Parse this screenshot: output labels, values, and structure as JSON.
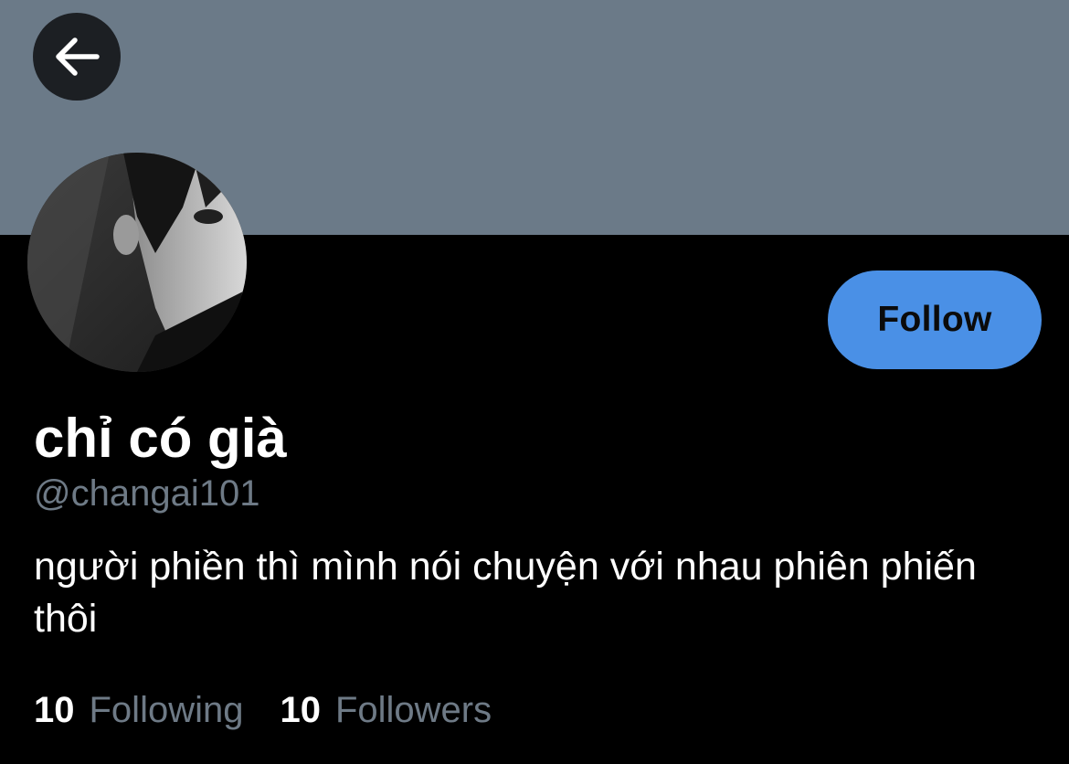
{
  "header": {
    "back_icon": "arrow-left-icon",
    "banner_color": "#6b7a88"
  },
  "profile": {
    "avatar_icon": "profile-photo",
    "display_name": "chỉ có già",
    "handle": "@changai101",
    "bio": "người phiền thì mình nói chuyện với nhau phiên phiến thôi",
    "follow_label": "Follow",
    "follow_color": "#4a90e6"
  },
  "stats": {
    "following_count": "10",
    "following_label": "Following",
    "followers_count": "10",
    "followers_label": "Followers"
  }
}
